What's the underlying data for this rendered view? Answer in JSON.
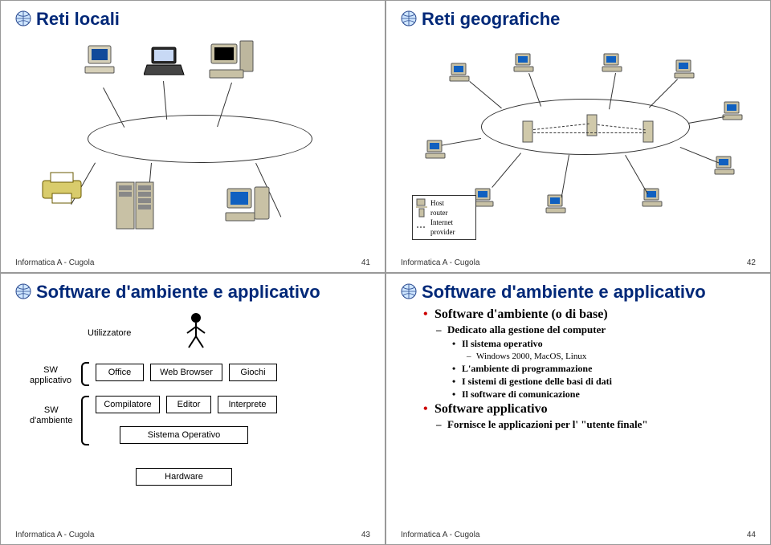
{
  "slides": {
    "s41": {
      "title": "Reti locali",
      "footer_left": "Informatica A - Cugola",
      "footer_right": "41"
    },
    "s42": {
      "title": "Reti geografiche",
      "legend": {
        "host": "Host",
        "router": "router",
        "isp": "Internet provider"
      },
      "footer_left": "Informatica A - Cugola",
      "footer_right": "42"
    },
    "s43": {
      "title": "Software d'ambiente e applicativo",
      "labels": {
        "utilizzatore": "Utilizzatore",
        "sw_applicativo": "SW\napplicativo",
        "sw_ambiente": "SW\nd'ambiente",
        "office": "Office",
        "web_browser": "Web Browser",
        "giochi": "Giochi",
        "compilatore": "Compilatore",
        "editor": "Editor",
        "interprete": "Interprete",
        "sistema_operativo": "Sistema Operativo",
        "hardware": "Hardware"
      },
      "footer_left": "Informatica A - Cugola",
      "footer_right": "43"
    },
    "s44": {
      "title": "Software d'ambiente e applicativo",
      "bullets": {
        "b1": "Software d'ambiente (o di base)",
        "b1_1": "Dedicato alla gestione del computer",
        "b1_1_1": "Il sistema operativo",
        "b1_1_1_1": "Windows 2000, MacOS, Linux",
        "b1_1_2": "L'ambiente di programmazione",
        "b1_1_3": "I sistemi di gestione delle basi di dati",
        "b1_1_4": "Il software di comunicazione",
        "b2": "Software applicativo",
        "b2_1": "Fornisce le applicazioni per l' \"utente finale\""
      },
      "footer_left": "Informatica A - Cugola",
      "footer_right": "44"
    }
  }
}
